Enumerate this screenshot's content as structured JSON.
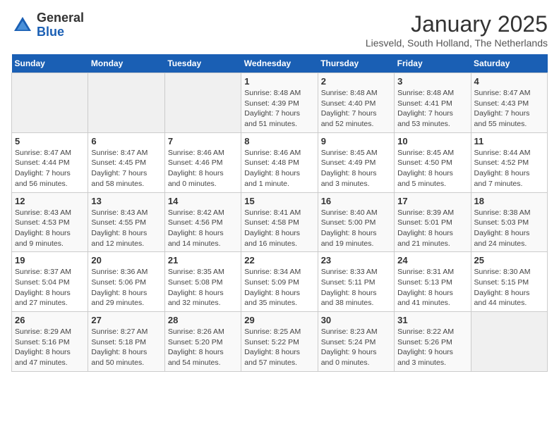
{
  "logo": {
    "general": "General",
    "blue": "Blue"
  },
  "header": {
    "title": "January 2025",
    "location": "Liesveld, South Holland, The Netherlands"
  },
  "weekdays": [
    "Sunday",
    "Monday",
    "Tuesday",
    "Wednesday",
    "Thursday",
    "Friday",
    "Saturday"
  ],
  "weeks": [
    [
      {
        "day": "",
        "info": ""
      },
      {
        "day": "",
        "info": ""
      },
      {
        "day": "",
        "info": ""
      },
      {
        "day": "1",
        "info": "Sunrise: 8:48 AM\nSunset: 4:39 PM\nDaylight: 7 hours\nand 51 minutes."
      },
      {
        "day": "2",
        "info": "Sunrise: 8:48 AM\nSunset: 4:40 PM\nDaylight: 7 hours\nand 52 minutes."
      },
      {
        "day": "3",
        "info": "Sunrise: 8:48 AM\nSunset: 4:41 PM\nDaylight: 7 hours\nand 53 minutes."
      },
      {
        "day": "4",
        "info": "Sunrise: 8:47 AM\nSunset: 4:43 PM\nDaylight: 7 hours\nand 55 minutes."
      }
    ],
    [
      {
        "day": "5",
        "info": "Sunrise: 8:47 AM\nSunset: 4:44 PM\nDaylight: 7 hours\nand 56 minutes."
      },
      {
        "day": "6",
        "info": "Sunrise: 8:47 AM\nSunset: 4:45 PM\nDaylight: 7 hours\nand 58 minutes."
      },
      {
        "day": "7",
        "info": "Sunrise: 8:46 AM\nSunset: 4:46 PM\nDaylight: 8 hours\nand 0 minutes."
      },
      {
        "day": "8",
        "info": "Sunrise: 8:46 AM\nSunset: 4:48 PM\nDaylight: 8 hours\nand 1 minute."
      },
      {
        "day": "9",
        "info": "Sunrise: 8:45 AM\nSunset: 4:49 PM\nDaylight: 8 hours\nand 3 minutes."
      },
      {
        "day": "10",
        "info": "Sunrise: 8:45 AM\nSunset: 4:50 PM\nDaylight: 8 hours\nand 5 minutes."
      },
      {
        "day": "11",
        "info": "Sunrise: 8:44 AM\nSunset: 4:52 PM\nDaylight: 8 hours\nand 7 minutes."
      }
    ],
    [
      {
        "day": "12",
        "info": "Sunrise: 8:43 AM\nSunset: 4:53 PM\nDaylight: 8 hours\nand 9 minutes."
      },
      {
        "day": "13",
        "info": "Sunrise: 8:43 AM\nSunset: 4:55 PM\nDaylight: 8 hours\nand 12 minutes."
      },
      {
        "day": "14",
        "info": "Sunrise: 8:42 AM\nSunset: 4:56 PM\nDaylight: 8 hours\nand 14 minutes."
      },
      {
        "day": "15",
        "info": "Sunrise: 8:41 AM\nSunset: 4:58 PM\nDaylight: 8 hours\nand 16 minutes."
      },
      {
        "day": "16",
        "info": "Sunrise: 8:40 AM\nSunset: 5:00 PM\nDaylight: 8 hours\nand 19 minutes."
      },
      {
        "day": "17",
        "info": "Sunrise: 8:39 AM\nSunset: 5:01 PM\nDaylight: 8 hours\nand 21 minutes."
      },
      {
        "day": "18",
        "info": "Sunrise: 8:38 AM\nSunset: 5:03 PM\nDaylight: 8 hours\nand 24 minutes."
      }
    ],
    [
      {
        "day": "19",
        "info": "Sunrise: 8:37 AM\nSunset: 5:04 PM\nDaylight: 8 hours\nand 27 minutes."
      },
      {
        "day": "20",
        "info": "Sunrise: 8:36 AM\nSunset: 5:06 PM\nDaylight: 8 hours\nand 29 minutes."
      },
      {
        "day": "21",
        "info": "Sunrise: 8:35 AM\nSunset: 5:08 PM\nDaylight: 8 hours\nand 32 minutes."
      },
      {
        "day": "22",
        "info": "Sunrise: 8:34 AM\nSunset: 5:09 PM\nDaylight: 8 hours\nand 35 minutes."
      },
      {
        "day": "23",
        "info": "Sunrise: 8:33 AM\nSunset: 5:11 PM\nDaylight: 8 hours\nand 38 minutes."
      },
      {
        "day": "24",
        "info": "Sunrise: 8:31 AM\nSunset: 5:13 PM\nDaylight: 8 hours\nand 41 minutes."
      },
      {
        "day": "25",
        "info": "Sunrise: 8:30 AM\nSunset: 5:15 PM\nDaylight: 8 hours\nand 44 minutes."
      }
    ],
    [
      {
        "day": "26",
        "info": "Sunrise: 8:29 AM\nSunset: 5:16 PM\nDaylight: 8 hours\nand 47 minutes."
      },
      {
        "day": "27",
        "info": "Sunrise: 8:27 AM\nSunset: 5:18 PM\nDaylight: 8 hours\nand 50 minutes."
      },
      {
        "day": "28",
        "info": "Sunrise: 8:26 AM\nSunset: 5:20 PM\nDaylight: 8 hours\nand 54 minutes."
      },
      {
        "day": "29",
        "info": "Sunrise: 8:25 AM\nSunset: 5:22 PM\nDaylight: 8 hours\nand 57 minutes."
      },
      {
        "day": "30",
        "info": "Sunrise: 8:23 AM\nSunset: 5:24 PM\nDaylight: 9 hours\nand 0 minutes."
      },
      {
        "day": "31",
        "info": "Sunrise: 8:22 AM\nSunset: 5:26 PM\nDaylight: 9 hours\nand 3 minutes."
      },
      {
        "day": "",
        "info": ""
      }
    ]
  ]
}
